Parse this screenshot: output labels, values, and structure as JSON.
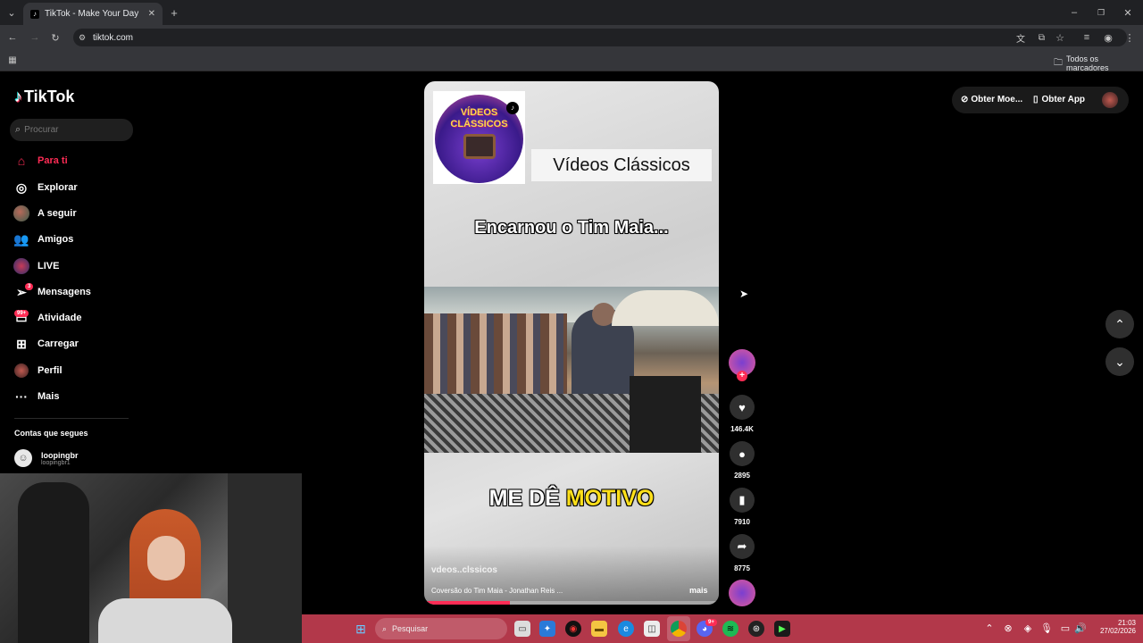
{
  "browser": {
    "tab_title": "TikTok - Make Your Day",
    "url": "tiktok.com",
    "bookmarks_label": "Todos os marcadores"
  },
  "sidebar": {
    "logo": "TikTok",
    "search_placeholder": "Procurar",
    "items": [
      {
        "label": "Para ti",
        "icon": "home-icon"
      },
      {
        "label": "Explorar",
        "icon": "compass-icon"
      },
      {
        "label": "A seguir",
        "icon": "following-avatar-icon"
      },
      {
        "label": "Amigos",
        "icon": "friends-icon"
      },
      {
        "label": "LIVE",
        "icon": "live-icon"
      },
      {
        "label": "Mensagens",
        "icon": "messages-icon",
        "badge": "3"
      },
      {
        "label": "Atividade",
        "icon": "activity-icon",
        "badge": "99+"
      },
      {
        "label": "Carregar",
        "icon": "upload-icon"
      },
      {
        "label": "Perfil",
        "icon": "profile-icon"
      },
      {
        "label": "Mais",
        "icon": "more-icon"
      }
    ],
    "following_title": "Contas que segues",
    "following": [
      {
        "name": "loopingbr",
        "handle": "loopingbr1"
      }
    ]
  },
  "header": {
    "coins_label": "Obter Moe...",
    "app_label": "Obter App"
  },
  "video": {
    "channel_title": "Vídeos Clássicos",
    "logo_text_1": "VÍDEOS",
    "logo_text_2": "CLÁSSICOS",
    "caption_top": "Encarnou o Tim Maia...",
    "caption_bottom_1": "ME DÊ",
    "caption_bottom_2": "MOTIVO",
    "author": "vdeos..clssicos",
    "description": "Coversão do Tim Maia - Jonathan Reis ...",
    "more_label": "mais",
    "progress": 0.29
  },
  "actions": {
    "likes": "146.4K",
    "comments": "2895",
    "saves": "7910",
    "shares": "8775"
  },
  "taskbar": {
    "search_placeholder": "Pesquisar",
    "time": "21:03",
    "date": "27/02/2026",
    "discord_badge": "9+"
  },
  "colors": {
    "accent": "#fe2c55",
    "taskbar": "#b2384a",
    "caption_highlight": "#ffe01a"
  }
}
